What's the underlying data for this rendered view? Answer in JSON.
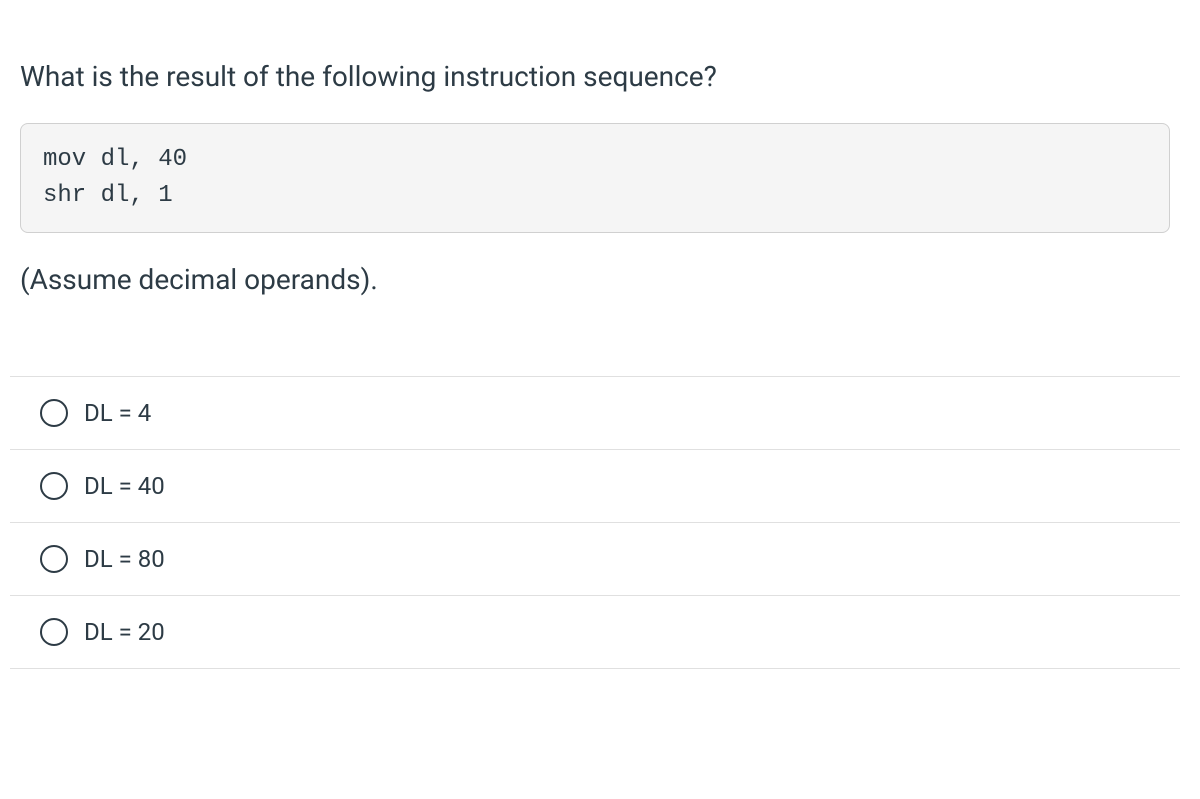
{
  "question": {
    "prompt": "What is the result of the following instruction sequence?",
    "code": "mov dl, 40\nshr dl, 1",
    "note": "(Assume decimal operands)."
  },
  "options": [
    {
      "label": "DL = 4"
    },
    {
      "label": "DL = 40"
    },
    {
      "label": "DL = 80"
    },
    {
      "label": "DL = 20"
    }
  ]
}
